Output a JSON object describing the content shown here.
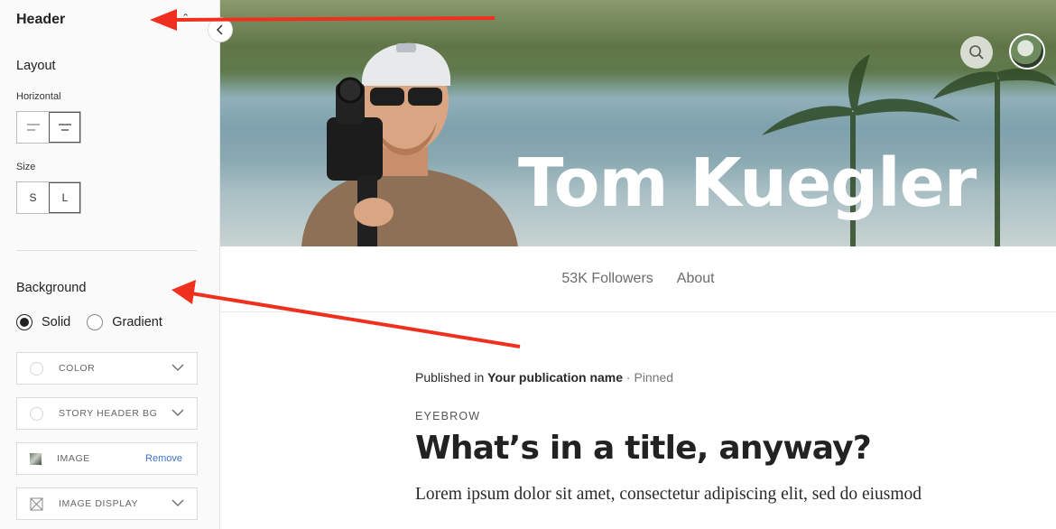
{
  "sidebar": {
    "title": "Header",
    "layout_label": "Layout",
    "horizontal_label": "Horizontal",
    "size_label": "Size",
    "size_options": [
      "S",
      "L"
    ],
    "background_label": "Background",
    "radio_solid": "Solid",
    "radio_gradient": "Gradient",
    "field_color": "COLOR",
    "field_story_header_bg": "STORY HEADER BG",
    "field_image": "IMAGE",
    "field_image_remove": "Remove",
    "field_image_display": "IMAGE DISPLAY"
  },
  "hero": {
    "name": "Tom Kuegler"
  },
  "nav": {
    "followers": "53K Followers",
    "about": "About"
  },
  "post": {
    "published_prefix": "Published in ",
    "publication": "Your publication name",
    "pinned": " · Pinned",
    "eyebrow": "EYEBROW",
    "title": "What’s in a title, anyway?",
    "excerpt": "Lorem ipsum dolor sit amet, consectetur adipiscing elit, sed do eiusmod"
  },
  "colors": {
    "annotation_arrow": "#f0301e",
    "link_blue": "#3b73c9"
  }
}
